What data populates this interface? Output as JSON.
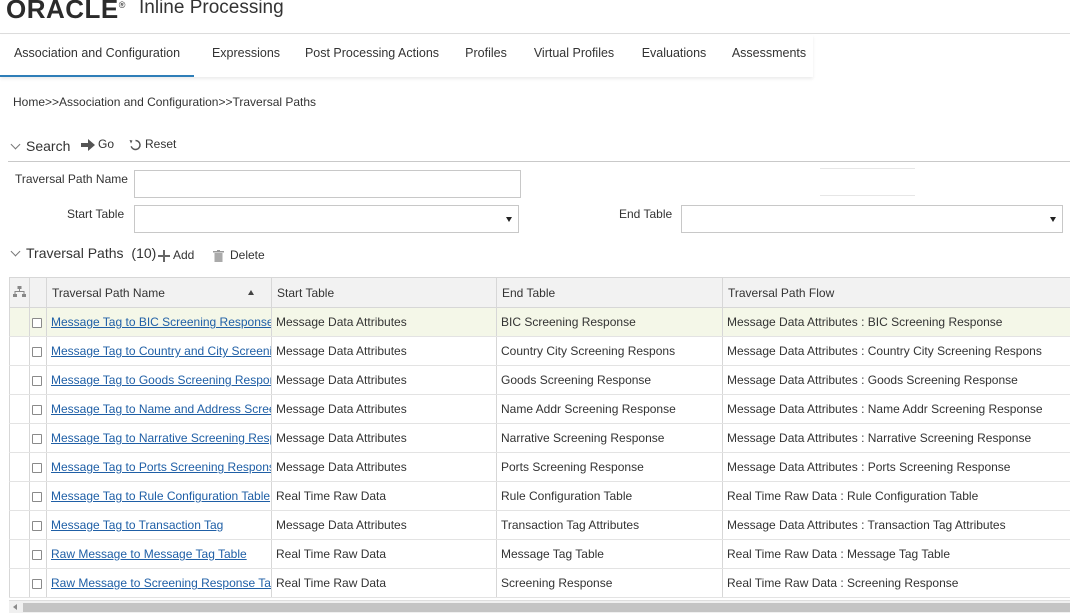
{
  "brand": {
    "logo": "ORACLE",
    "app_title": "Inline Processing"
  },
  "tabs": [
    {
      "label": "Association and Configuration"
    },
    {
      "label": "Expressions"
    },
    {
      "label": "Post Processing Actions"
    },
    {
      "label": "Profiles"
    },
    {
      "label": "Virtual Profiles"
    },
    {
      "label": "Evaluations"
    },
    {
      "label": "Assessments"
    }
  ],
  "breadcrumb": "Home>>Association and Configuration>>Traversal Paths",
  "search": {
    "title": "Search",
    "go_label": "Go",
    "reset_label": "Reset",
    "traversal_path_name_label": "Traversal Path Name",
    "traversal_path_name_value": "",
    "start_table_label": "Start Table",
    "start_table_value": "",
    "end_table_label": "End Table",
    "end_table_value": ""
  },
  "results": {
    "title": "Traversal Paths",
    "count": "(10)",
    "add_label": "Add",
    "delete_label": "Delete",
    "columns": [
      "Traversal Path Name",
      "Start Table",
      "End Table",
      "Traversal Path Flow"
    ],
    "rows": [
      {
        "name": "Message Tag to BIC Screening Response",
        "start": "Message Data Attributes",
        "end": "BIC Screening Response",
        "flow": "Message Data Attributes : BIC Screening Response"
      },
      {
        "name": "Message Tag to Country and City Screening Response",
        "start": "Message Data Attributes",
        "end": "Country City Screening Respons",
        "flow": "Message Data Attributes : Country City Screening Respons"
      },
      {
        "name": "Message Tag to Goods Screening Response",
        "start": "Message Data Attributes",
        "end": "Goods Screening Response",
        "flow": "Message Data Attributes : Goods Screening Response"
      },
      {
        "name": "Message Tag to Name and Address Screening Response",
        "start": "Message Data Attributes",
        "end": "Name Addr Screening Response",
        "flow": "Message Data Attributes : Name Addr Screening Response"
      },
      {
        "name": "Message Tag to Narrative Screening Response",
        "start": "Message Data Attributes",
        "end": "Narrative Screening Response",
        "flow": "Message Data Attributes : Narrative Screening Response"
      },
      {
        "name": "Message Tag to Ports Screening Response",
        "start": "Message Data Attributes",
        "end": "Ports Screening Response",
        "flow": "Message Data Attributes : Ports Screening Response"
      },
      {
        "name": "Message Tag to Rule Configuration Table",
        "start": "Real Time Raw Data",
        "end": "Rule Configuration Table",
        "flow": "Real Time Raw Data : Rule Configuration Table"
      },
      {
        "name": "Message Tag to Transaction Tag",
        "start": "Message Data Attributes",
        "end": "Transaction Tag Attributes",
        "flow": "Message Data Attributes : Transaction Tag Attributes"
      },
      {
        "name": "Raw Message to Message Tag Table",
        "start": "Real Time Raw Data",
        "end": "Message Tag Table",
        "flow": "Real Time Raw Data : Message Tag Table"
      },
      {
        "name": "Raw Message to Screening Response Table",
        "start": "Real Time Raw Data",
        "end": "Screening Response",
        "flow": "Real Time Raw Data : Screening Response"
      }
    ]
  },
  "colors": {
    "link": "#1f5fa6",
    "active_tab_underline": "#2e7eb8",
    "selected_row": "#f4f7e8"
  },
  "icons": [
    "go-arrow-icon",
    "reset-icon",
    "add-icon",
    "delete-icon",
    "hierarchy-icon",
    "sort-ascending-icon",
    "chevron-down-icon"
  ]
}
